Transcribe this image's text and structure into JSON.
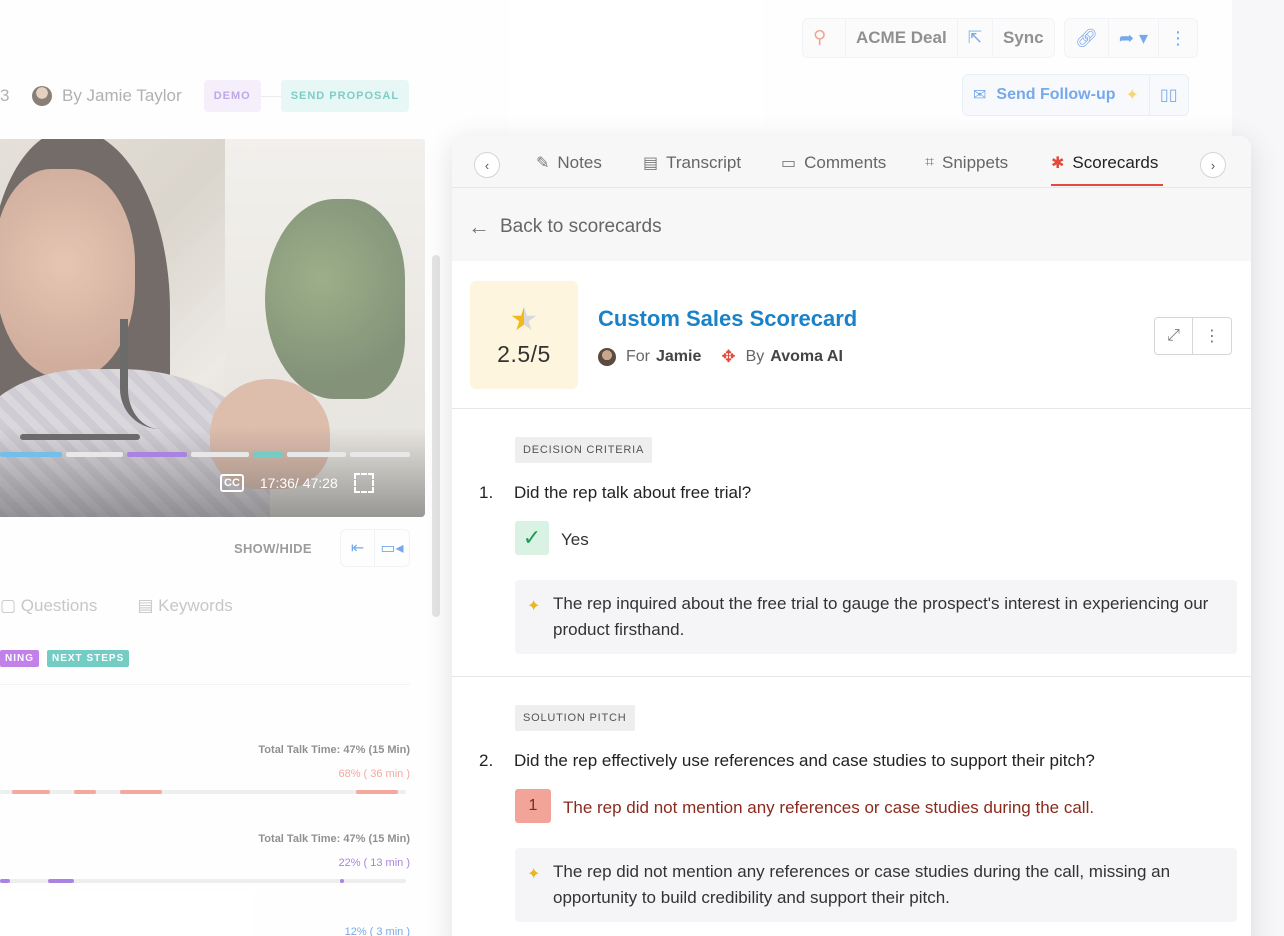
{
  "header": {
    "crm_label": "ACME Deal",
    "sync_label": "Sync",
    "send_followup_label": "Send Follow-up",
    "meeting_num": "3",
    "by_label": "By Jamie Taylor",
    "stage_demo": "DEMO",
    "stage_proposal": "SEND PROPOSAL"
  },
  "video": {
    "timestamp": "17:36/ 47:28",
    "cc_label": "CC"
  },
  "left_panel": {
    "show_hide_label": "SHOW/HIDE",
    "tabs": [
      "Questions",
      "Keywords"
    ],
    "tags": [
      "NING",
      "NEXT STEPS"
    ],
    "talk_rows": [
      {
        "title": "Total Talk Time: 47% (15 Min)",
        "pct": "68%  ( 36 min )",
        "color": "#f07a6a"
      },
      {
        "title": "Total Talk Time: 47% (15 Min)",
        "pct": "22%  ( 13 min )",
        "color": "#7b3fd4"
      },
      {
        "pct": "12%  ( 3 min )",
        "color": "#2d7be0"
      }
    ]
  },
  "panel": {
    "tabs": [
      {
        "label": "Notes",
        "icon": "notes-icon"
      },
      {
        "label": "Transcript",
        "icon": "transcript-icon"
      },
      {
        "label": "Comments",
        "icon": "comments-icon"
      },
      {
        "label": "Snippets",
        "icon": "snippets-icon"
      },
      {
        "label": "Scorecards",
        "icon": "scorecards-icon",
        "active": true
      }
    ],
    "back_label": "Back to scorecards",
    "score": "2.5/5",
    "score_rating": 2.5,
    "score_max": 5,
    "title": "Custom Sales Scorecard",
    "for_label": "For",
    "for_name": "Jamie",
    "by_label": "By",
    "by_name": "Avoma AI",
    "questions": [
      {
        "category": "DECISION CRITERIA",
        "number": "1.",
        "text": "Did the rep talk about free trial?",
        "answer": "Yes",
        "ai_summary": "The rep inquired about the free trial to gauge the prospect's interest in experiencing our product firsthand."
      },
      {
        "category": "SOLUTION PITCH",
        "number": "2.",
        "text": "Did the rep effectively use references and case studies to support their pitch?",
        "score": "1",
        "answer": "The rep did not mention any references or case studies during the call.",
        "ai_summary": "The rep did not mention any references or case studies during the call, missing an opportunity to build credibility and support their pitch."
      }
    ]
  },
  "colors": {
    "accent": "#1a82c9",
    "active_tab": "#e24b3c",
    "star": "#f3b81b"
  }
}
